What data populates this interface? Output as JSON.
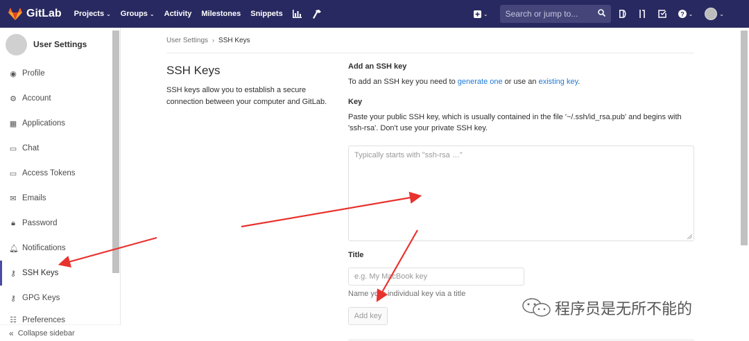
{
  "navbar": {
    "brand": "GitLab",
    "links": [
      {
        "label": "Projects",
        "dropdown": true
      },
      {
        "label": "Groups",
        "dropdown": true
      },
      {
        "label": "Activity",
        "dropdown": false
      },
      {
        "label": "Milestones",
        "dropdown": false
      },
      {
        "label": "Snippets",
        "dropdown": false
      }
    ],
    "search_placeholder": "Search or jump to...",
    "icons": [
      "chart-icon",
      "wrench-icon",
      "plus-square-icon",
      "issues-icon",
      "merge-request-icon",
      "todo-icon",
      "help-icon",
      "avatar-icon"
    ]
  },
  "sidebar": {
    "title": "User Settings",
    "items": [
      {
        "label": "Profile",
        "icon": "profile-icon"
      },
      {
        "label": "Account",
        "icon": "account-icon"
      },
      {
        "label": "Applications",
        "icon": "applications-icon"
      },
      {
        "label": "Chat",
        "icon": "chat-icon"
      },
      {
        "label": "Access Tokens",
        "icon": "token-icon"
      },
      {
        "label": "Emails",
        "icon": "email-icon"
      },
      {
        "label": "Password",
        "icon": "lock-icon"
      },
      {
        "label": "Notifications",
        "icon": "bell-icon"
      },
      {
        "label": "SSH Keys",
        "icon": "key-icon",
        "active": true
      },
      {
        "label": "GPG Keys",
        "icon": "key-icon"
      },
      {
        "label": "Preferences",
        "icon": "preferences-icon"
      }
    ],
    "collapse_label": "Collapse sidebar"
  },
  "breadcrumb": {
    "parent": "User Settings",
    "current": "SSH Keys"
  },
  "intro": {
    "title": "SSH Keys",
    "description": "SSH keys allow you to establish a secure connection between your computer and GitLab."
  },
  "form": {
    "heading": "Add an SSH key",
    "help_prefix": "To add an SSH key you need to ",
    "help_link1": "generate one",
    "help_middle": " or use an ",
    "help_link2": "existing key",
    "help_suffix": ".",
    "key_label": "Key",
    "key_help": "Paste your public SSH key, which is usually contained in the file '~/.ssh/id_rsa.pub' and begins with 'ssh-rsa'. Don't use your private SSH key.",
    "key_placeholder": "Typically starts with \"ssh-rsa …\"",
    "title_label": "Title",
    "title_placeholder": "e.g. My MacBook key",
    "title_help": "Name your individual key via a title",
    "submit_label": "Add key"
  },
  "watermark": {
    "text": "程序员是无所不能的"
  },
  "colors": {
    "navbar": "#292961",
    "link": "#1f78d1",
    "annotation_arrow": "#e8322e"
  }
}
